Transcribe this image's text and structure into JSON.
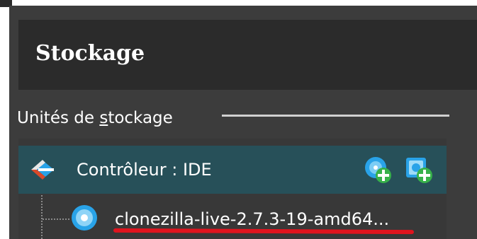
{
  "panel": {
    "title": "Stockage"
  },
  "storage_group": {
    "label_before": "Unités de ",
    "label_accel": "s",
    "label_after": "tockage"
  },
  "tree": {
    "controller": {
      "label": "Contrôleur : IDE",
      "icon": "ide-controller-icon",
      "actions": [
        {
          "icon": "add-optical-drive-icon"
        },
        {
          "icon": "add-hard-disk-icon"
        }
      ]
    },
    "attachments": [
      {
        "label": "clonezilla-live-2.7.3-19-amd64...",
        "icon": "optical-disc-icon"
      }
    ]
  },
  "colors": {
    "frame": "#3c3c3c",
    "header": "#2b2b2b",
    "selected_row": "#275059",
    "annotation_underline": "#e0141e",
    "icon_blue": "#29a3e8",
    "icon_green": "#37b14a"
  }
}
